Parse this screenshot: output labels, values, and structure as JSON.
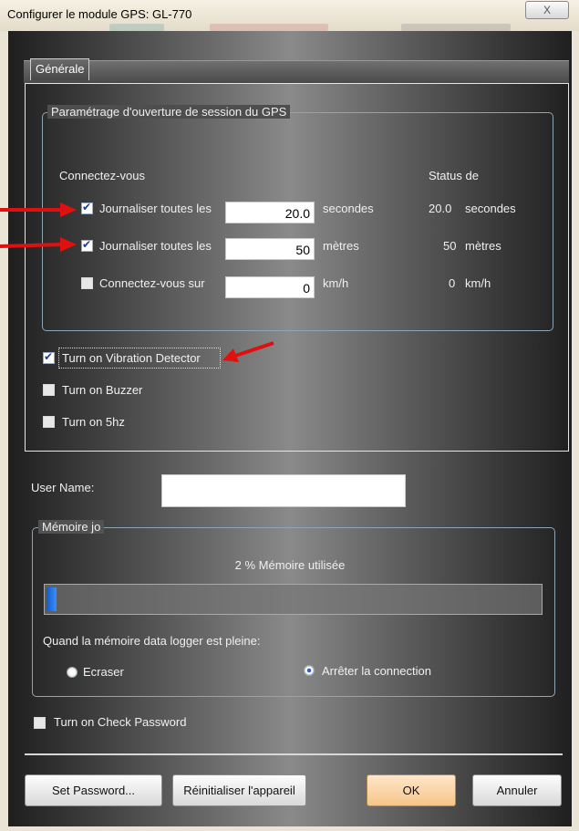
{
  "window": {
    "title": "Configurer le module GPS: GL-770",
    "close_glyph": "X"
  },
  "tabs": [
    {
      "label": "Générale",
      "selected": true
    }
  ],
  "session_group": {
    "legend": "Paramétrage d'ouverture de session du GPS",
    "header_left": "Connectez-vous",
    "header_right": "Status de",
    "rows": [
      {
        "checked": true,
        "label": "Journaliser toutes les",
        "value": "20.0",
        "unit": "secondes",
        "status_value": "20.0",
        "status_unit": "secondes"
      },
      {
        "checked": true,
        "label": "Journaliser toutes les",
        "value": "50",
        "unit": "mètres",
        "status_value": "50",
        "status_unit": "mètres"
      },
      {
        "checked": false,
        "label": "Connectez-vous sur",
        "value": "0",
        "unit": "km/h",
        "status_value": "0",
        "status_unit": "km/h"
      }
    ]
  },
  "options": [
    {
      "label": "Turn on Vibration Detector",
      "checked": true
    },
    {
      "label": "Turn on Buzzer",
      "checked": false
    },
    {
      "label": "Turn on 5hz",
      "checked": false
    }
  ],
  "user_name": {
    "label": "User Name:",
    "value": ""
  },
  "memory_group": {
    "legend": "Mémoire jo",
    "usage_text": "2 % Mémoire utilisée",
    "usage_percent": 2,
    "full_label": "Quand la mémoire data logger est pleine:",
    "radio_overwrite": {
      "label": "Ecraser",
      "selected": false
    },
    "radio_stop": {
      "label": "Arrêter la connection",
      "selected": true
    }
  },
  "check_password": {
    "label": "Turn on Check Password",
    "checked": false
  },
  "buttons": {
    "set_password": "Set Password...",
    "reset": "Réinitialiser l'appareil",
    "ok": "OK",
    "cancel": "Annuler"
  },
  "colors": {
    "annotation_arrow": "#e01010",
    "progress_fill": "#1f6fe0",
    "ok_button": "#f8cf96"
  }
}
